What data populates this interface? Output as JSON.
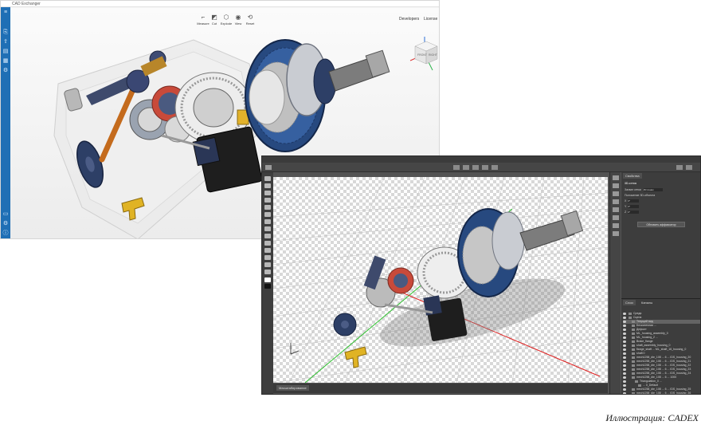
{
  "cad": {
    "title": "CAD Exchanger",
    "toolbar": [
      {
        "label": "Measure",
        "icon": "ruler-icon"
      },
      {
        "label": "Cut",
        "icon": "cut-plane-icon"
      },
      {
        "label": "Explode",
        "icon": "explode-icon"
      },
      {
        "label": "View",
        "icon": "eye-icon"
      },
      {
        "label": "Reset",
        "icon": "reset-icon"
      }
    ],
    "links": {
      "developers": "Developers",
      "license": "License"
    },
    "navcube": {
      "front": "FRONT",
      "right": "RIGHT"
    },
    "sidebar_icons": [
      "menu-icon",
      "import-icon",
      "export-icon",
      "document-icon",
      "file-icon",
      "gear-icon",
      "chat-icon",
      "settings-icon",
      "info-icon"
    ],
    "accent": "#1f6fb5"
  },
  "ps": {
    "panel_tab": "Свойства",
    "props_title": "3D-сетка",
    "props_fields": [
      {
        "label": "Захват сетки",
        "value": "Источник"
      },
      {
        "label": "Положение 3D-объекта",
        "value": ""
      },
      {
        "label": "X",
        "value": "0°"
      },
      {
        "label": "Y",
        "value": "0°"
      },
      {
        "label": "Z",
        "value": "0°"
      }
    ],
    "action_button": "Обновить аффиксатор",
    "layers_tabs": [
      "Слои",
      "Каналы"
    ],
    "layers": [
      {
        "name": "Среда",
        "indent": 0
      },
      {
        "name": "Сцена",
        "indent": 0
      },
      {
        "name": "Текущий вид",
        "indent": 1,
        "selected": true
      },
      {
        "name": "Бесконечная ...",
        "indent": 1
      },
      {
        "name": "Дефолт",
        "indent": 1
      },
      {
        "name": "ML_housing_assembly_0",
        "indent": 1
      },
      {
        "name": "ML_housing_2 ...",
        "indent": 1
      },
      {
        "name": "Brake_flange",
        "indent": 1
      },
      {
        "name": "shaft_assembly_housing_0",
        "indent": 1
      },
      {
        "name": "flange_shaft ... ML_shaft_16_housing_0",
        "indent": 1
      },
      {
        "name": "shaft 0",
        "indent": 1
      },
      {
        "name": "mech1258_die_108 ... 6 ... IDS_housing_20",
        "indent": 1
      },
      {
        "name": "mech1258_die_108 ... 6 ... IDS_housing_21",
        "indent": 1
      },
      {
        "name": "mech1258_die_108 ... 6 ... IDS_housing_22",
        "indent": 1
      },
      {
        "name": "mech1258_die_108 ... 6 ... IDS_housing_23",
        "indent": 1
      },
      {
        "name": "mech1258_die_108 ... 6 ... IDS_housing_24",
        "indent": 1
      },
      {
        "name": "mech1258_die_108 ... 6 ... 1000",
        "indent": 1
      },
      {
        "name": "Triangulation_0 ...",
        "indent": 2
      },
      {
        "name": "... 0_Default",
        "indent": 3
      },
      {
        "name": "mech1258_die_108 ... 6 ... IDS_housing_25",
        "indent": 1
      },
      {
        "name": "mech1258_die_108 ... 6 ... IDS_housing_26",
        "indent": 1
      }
    ],
    "status_zoom": "Масштабирование"
  },
  "caption": "Иллюстрация: CADEX"
}
